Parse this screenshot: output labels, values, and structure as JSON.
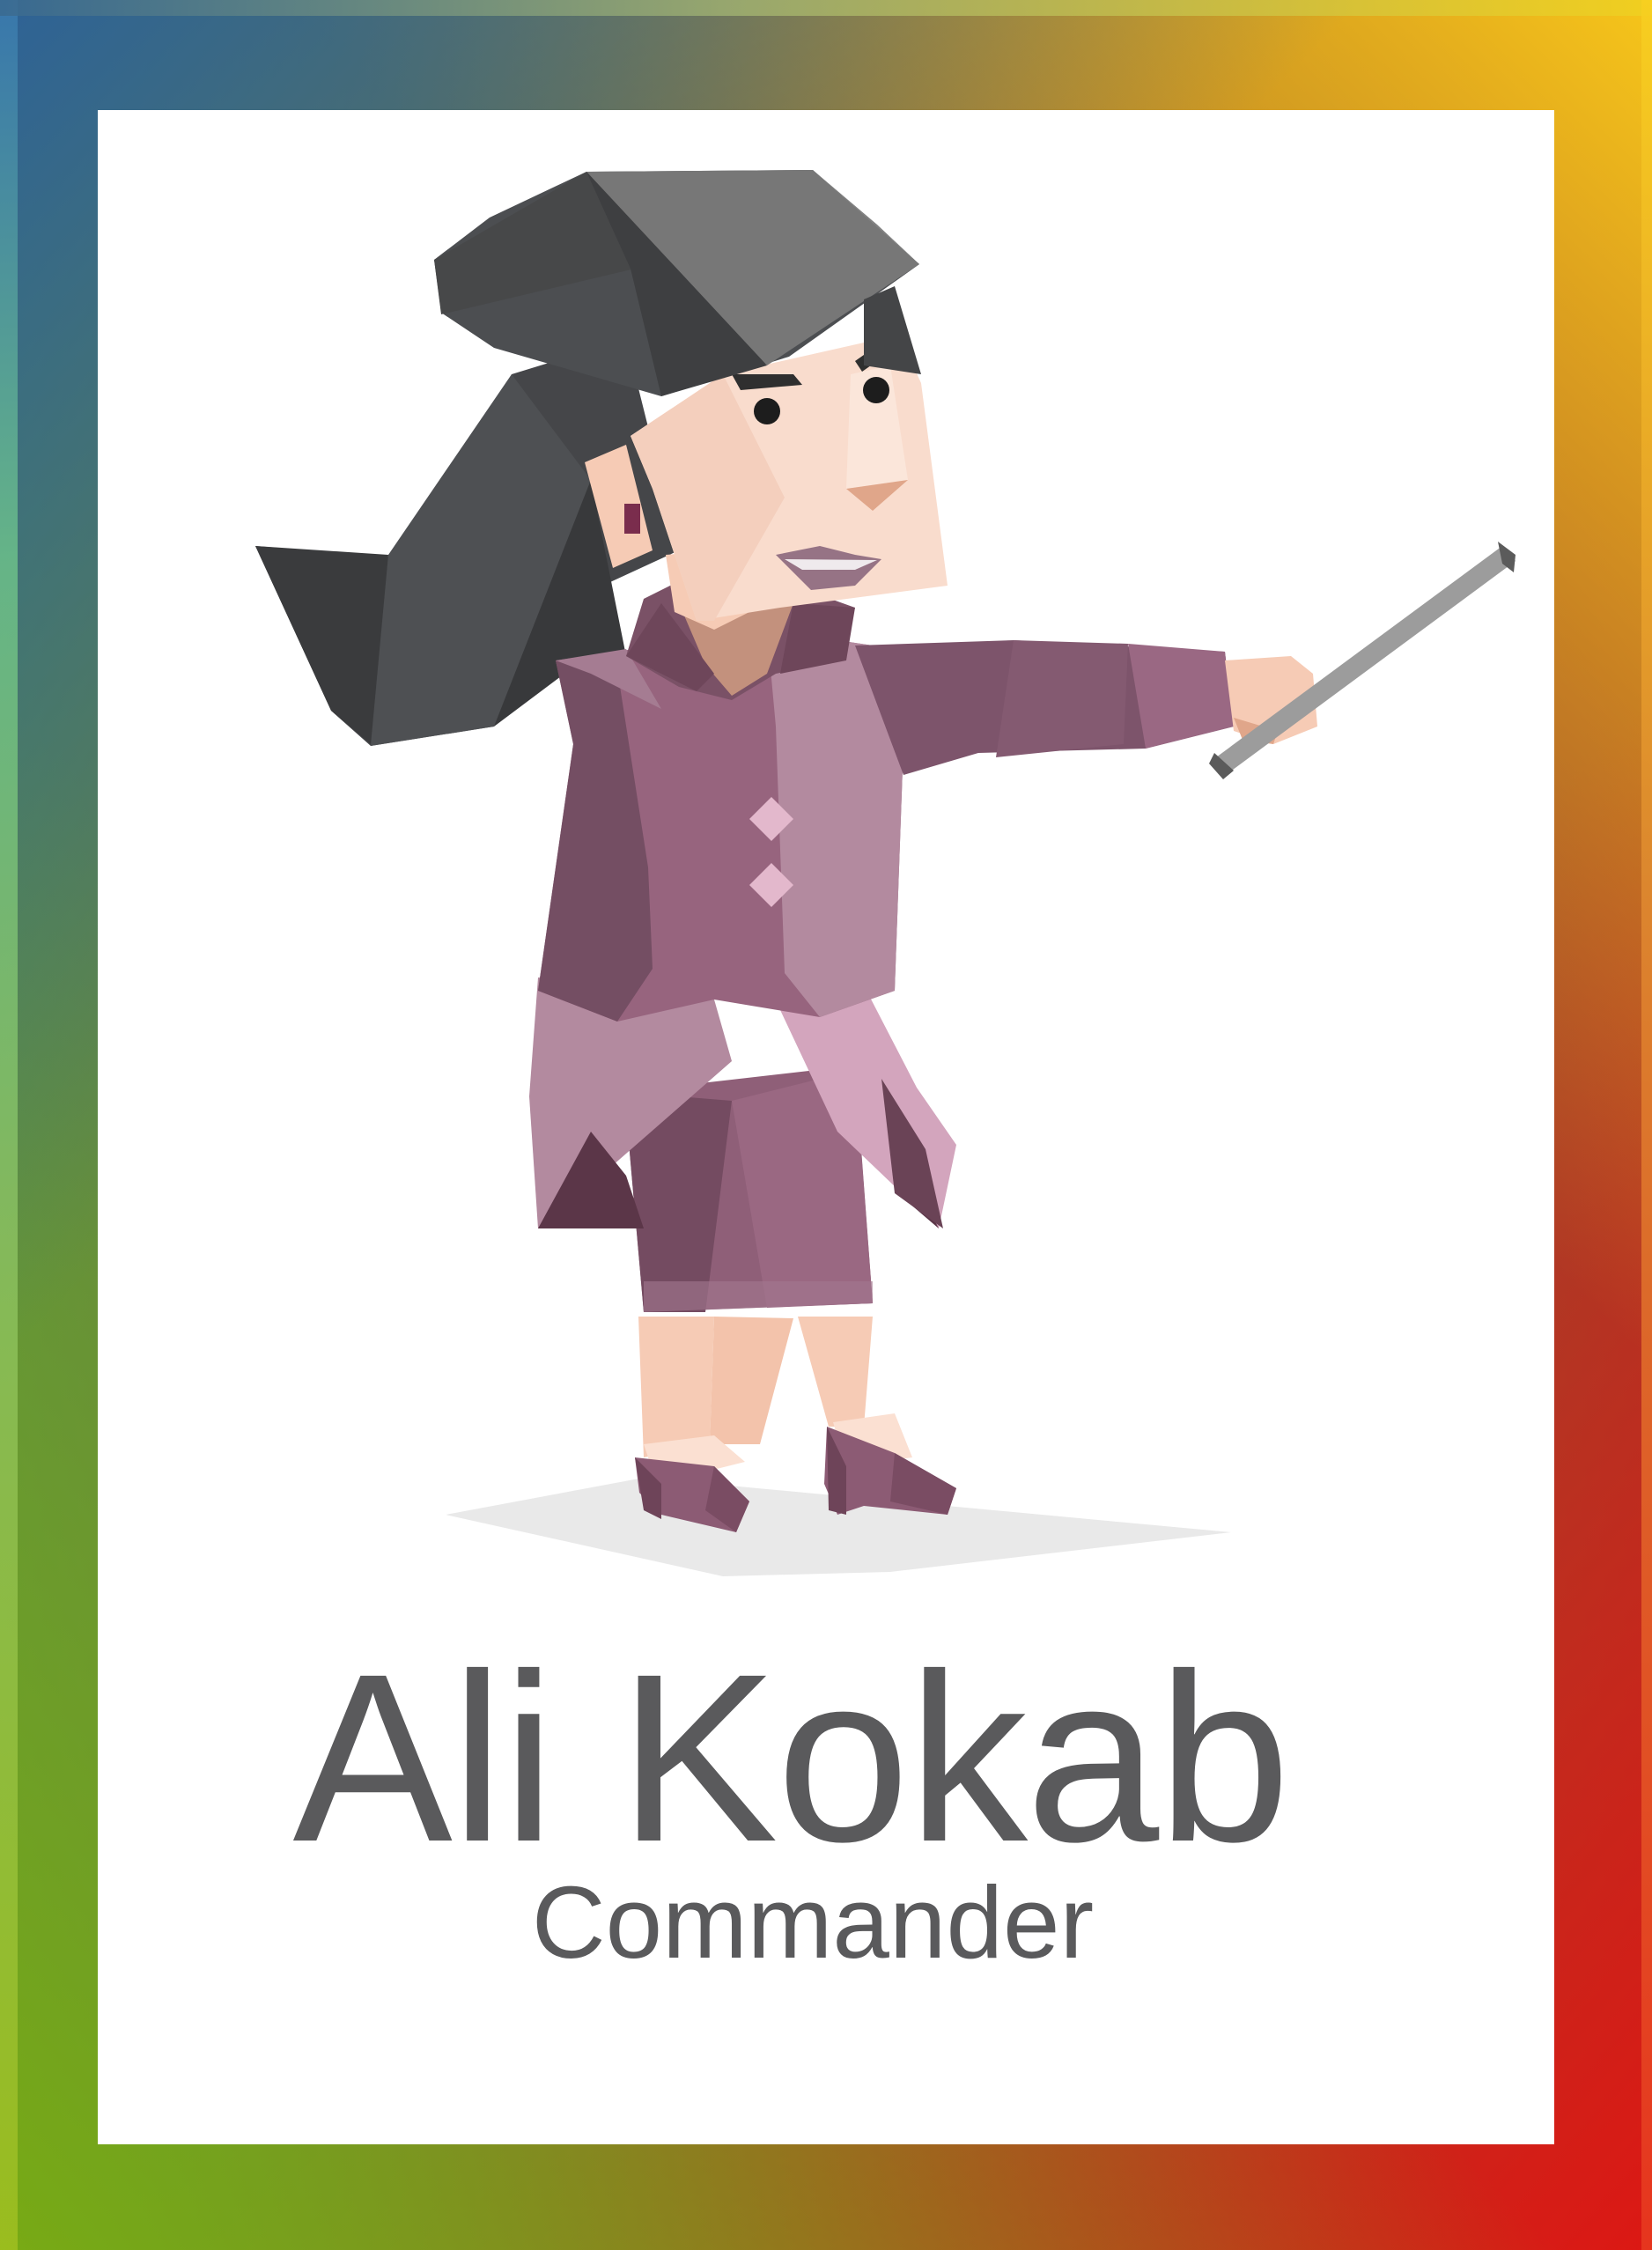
{
  "card": {
    "name": "Ali Kokab",
    "role": "Commander"
  },
  "illustration": {
    "subject": "geometric-woman-with-pointer",
    "colors": {
      "hair": "#4a4d50",
      "skin": "#f9dccd",
      "suit": "#8f5f78",
      "pointer": "#9c9c9c",
      "shadow": "#e9e9e9"
    }
  },
  "frame": {
    "gradient_colors": [
      "#2e6296",
      "#f6c61a",
      "#78aa14",
      "#dc1814"
    ]
  }
}
